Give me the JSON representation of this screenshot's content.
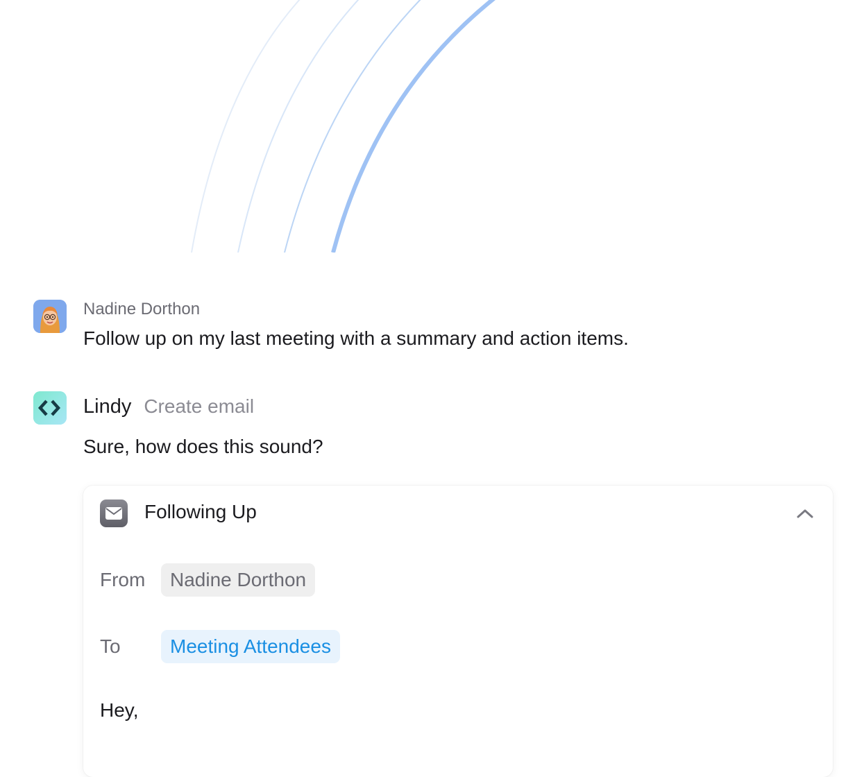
{
  "colors": {
    "arc_primary": "#9fc2f4",
    "arc_faint": "#cfe0f8",
    "chip_to_text": "#1a8fe3",
    "chip_to_bg": "#e8f3fd",
    "chip_from_bg": "#efefef"
  },
  "messages": {
    "user": {
      "name": "Nadine Dorthon",
      "text": "Follow up on my last meeting with a summary and action items.",
      "avatar_icon": "memoji-avatar-icon"
    },
    "bot": {
      "name": "Lindy",
      "action": "Create email",
      "text": "Sure, how does this sound?",
      "avatar_icon": "lindy-logo-icon"
    }
  },
  "email_card": {
    "title": "Following Up",
    "icon": "mail-icon",
    "collapse_icon": "chevron-up-icon",
    "from_label": "From",
    "from_value": "Nadine Dorthon",
    "to_label": "To",
    "to_value": "Meeting Attendees",
    "body_greeting": "Hey,"
  }
}
